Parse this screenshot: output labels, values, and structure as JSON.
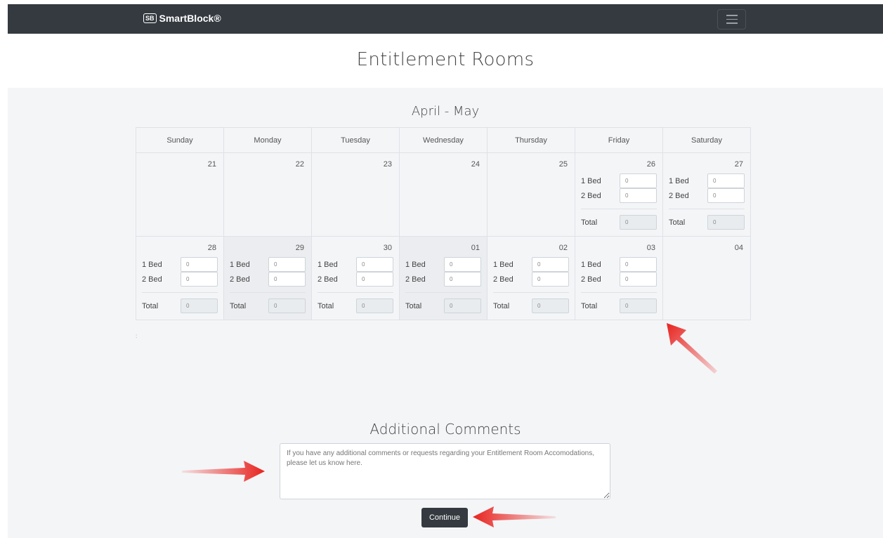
{
  "navbar": {
    "brand_mark": "SB",
    "brand_name": "SmartBlock®"
  },
  "page_title": "Entitlement Rooms",
  "calendar": {
    "month_title": "April - May",
    "weekdays": [
      "Sunday",
      "Monday",
      "Tuesday",
      "Wednesday",
      "Thursday",
      "Friday",
      "Saturday"
    ],
    "labels": {
      "bed1": "1 Bed",
      "bed2": "2 Bed",
      "total": "Total"
    },
    "weeks": [
      [
        {
          "day": "21"
        },
        {
          "day": "22"
        },
        {
          "day": "23"
        },
        {
          "day": "24"
        },
        {
          "day": "25"
        },
        {
          "day": "26",
          "bed1": "0",
          "bed2": "0",
          "total": "0"
        },
        {
          "day": "27",
          "bed1": "0",
          "bed2": "0",
          "total": "0"
        }
      ],
      [
        {
          "day": "28",
          "bed1": "0",
          "bed2": "0",
          "total": "0"
        },
        {
          "day": "29",
          "bed1": "0",
          "bed2": "0",
          "total": "0"
        },
        {
          "day": "30",
          "bed1": "0",
          "bed2": "0",
          "total": "0"
        },
        {
          "day": "01",
          "bed1": "0",
          "bed2": "0",
          "total": "0"
        },
        {
          "day": "02",
          "bed1": "0",
          "bed2": "0",
          "total": "0"
        },
        {
          "day": "03",
          "bed1": "0",
          "bed2": "0",
          "total": "0"
        },
        {
          "day": "04"
        }
      ]
    ]
  },
  "stray_mark": ":",
  "comments": {
    "title": "Additional Comments",
    "placeholder": "If you have any additional comments or requests regarding your Entitlement Room Accomodations, please let us know here."
  },
  "continue_label": "Continue",
  "colors": {
    "navbar": "#343a40",
    "panel": "#f4f5f7",
    "arrow": "#e8231f"
  }
}
